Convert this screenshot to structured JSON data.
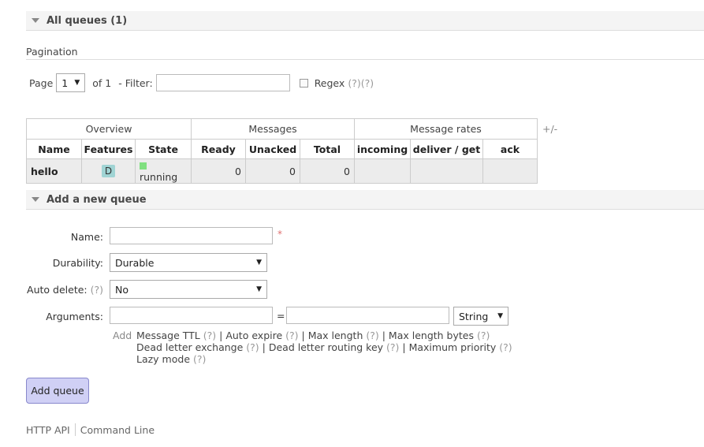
{
  "queues_section": {
    "title": "All queues (1)"
  },
  "pagination": {
    "label": "Pagination",
    "page_label": "Page",
    "page_value": "1",
    "of_label": "of 1",
    "filter_label": "- Filter:",
    "filter_value": "",
    "regex_label": "Regex",
    "regex_help": "(?)(?)"
  },
  "table": {
    "groups": [
      "Overview",
      "Messages",
      "Message rates"
    ],
    "columns": [
      "Name",
      "Features",
      "State",
      "Ready",
      "Unacked",
      "Total",
      "incoming",
      "deliver / get",
      "ack"
    ],
    "rows": [
      {
        "name": "hello",
        "features": "D",
        "state": "running",
        "ready": "0",
        "unacked": "0",
        "total": "0",
        "incoming": "",
        "deliver_get": "",
        "ack": ""
      }
    ],
    "toggle_columns": "+/-",
    "state_color": "#80e080",
    "feature_color": "#a0d4d4"
  },
  "add_section": {
    "title": "Add a new queue",
    "name_label": "Name:",
    "name_value": "",
    "required_mark": "*",
    "durability_label": "Durability:",
    "durability_value": "Durable",
    "auto_delete_label": "Auto delete:",
    "auto_delete_help": "(?)",
    "auto_delete_value": "No",
    "arguments_label": "Arguments:",
    "arg_key": "",
    "equals": "=",
    "arg_value": "",
    "arg_type": "String",
    "add_label": "Add",
    "arg_links": [
      {
        "label": "Message TTL",
        "help": "(?)"
      },
      {
        "label": "Auto expire",
        "help": "(?)"
      },
      {
        "label": "Max length",
        "help": "(?)"
      },
      {
        "label": "Max length bytes",
        "help": "(?)"
      },
      {
        "label": "Dead letter exchange",
        "help": "(?)"
      },
      {
        "label": "Dead letter routing key",
        "help": "(?)"
      },
      {
        "label": "Maximum priority",
        "help": "(?)"
      },
      {
        "label": "Lazy mode",
        "help": "(?)"
      }
    ],
    "button_label": "Add queue"
  },
  "footer": {
    "http_api": "HTTP API",
    "command_line": "Command Line"
  }
}
